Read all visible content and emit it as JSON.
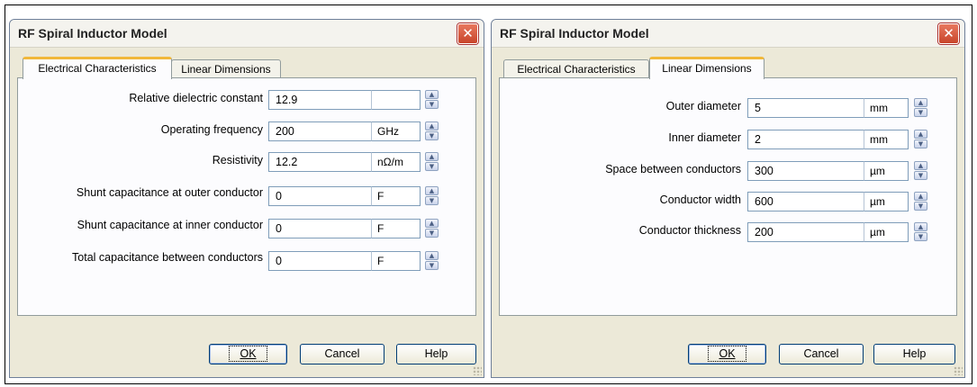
{
  "dialogs": [
    {
      "title": "RF Spiral Inductor Model",
      "close_glyph": "✕",
      "tabs": [
        "Electrical Characteristics",
        "Linear Dimensions"
      ],
      "active_tab": "Electrical Characteristics",
      "fields": [
        {
          "label": "Relative dielectric constant",
          "value": "12.9",
          "unit": ""
        },
        {
          "label": "Operating frequency",
          "value": "200",
          "unit": "GHz"
        },
        {
          "label": "Resistivity",
          "value": "12.2",
          "unit": "nΩ/m"
        },
        {
          "label": "Shunt capacitance at outer conductor",
          "value": "0",
          "unit": "F"
        },
        {
          "label": "Shunt capacitance at inner conductor",
          "value": "0",
          "unit": "F"
        },
        {
          "label": "Total capacitance between conductors",
          "value": "0",
          "unit": "F"
        }
      ],
      "buttons": {
        "ok": "OK",
        "cancel": "Cancel",
        "help": "Help"
      }
    },
    {
      "title": "RF Spiral Inductor Model",
      "close_glyph": "✕",
      "tabs": [
        "Electrical Characteristics",
        "Linear Dimensions"
      ],
      "active_tab": "Linear Dimensions",
      "fields": [
        {
          "label": "Outer diameter",
          "value": "5",
          "unit": "mm"
        },
        {
          "label": "Inner diameter",
          "value": "2",
          "unit": "mm"
        },
        {
          "label": "Space between conductors",
          "value": "300",
          "unit": "µm"
        },
        {
          "label": "Conductor width",
          "value": "600",
          "unit": "µm"
        },
        {
          "label": "Conductor thickness",
          "value": "200",
          "unit": "µm"
        }
      ],
      "buttons": {
        "ok": "OK",
        "cancel": "Cancel",
        "help": "Help"
      }
    }
  ],
  "icons": {
    "spin_up": "up-arrow",
    "spin_down": "down-arrow",
    "close": "close-x"
  },
  "colors": {
    "tab_highlight": "#f1b83a",
    "close_button": "#d65a3f",
    "dialog_bg": "#ece9d8"
  }
}
